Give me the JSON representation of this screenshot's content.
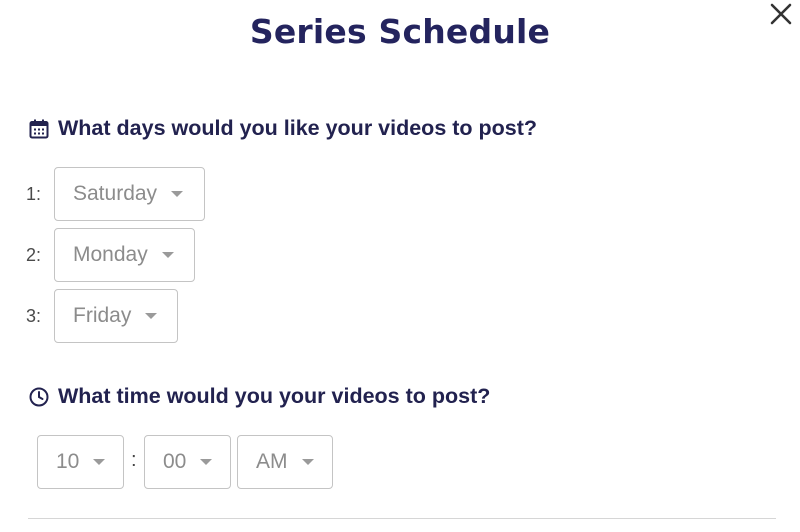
{
  "dialog": {
    "title": "Series Schedule",
    "close_icon": "close-icon"
  },
  "days_section": {
    "icon": "calendar-icon",
    "heading": "What days would you like your videos to post?",
    "rows": [
      {
        "number": "1:",
        "value": "Saturday"
      },
      {
        "number": "2:",
        "value": "Monday"
      },
      {
        "number": "3:",
        "value": "Friday"
      }
    ]
  },
  "time_section": {
    "icon": "clock-icon",
    "heading": "What time would you your videos to post?",
    "hour": "10",
    "separator": ":",
    "minute": "00",
    "meridiem": "AM"
  },
  "colors": {
    "title": "#24245e",
    "heading": "#22224f",
    "select_border": "#c4c4c4",
    "select_text": "#8c8c8c"
  }
}
